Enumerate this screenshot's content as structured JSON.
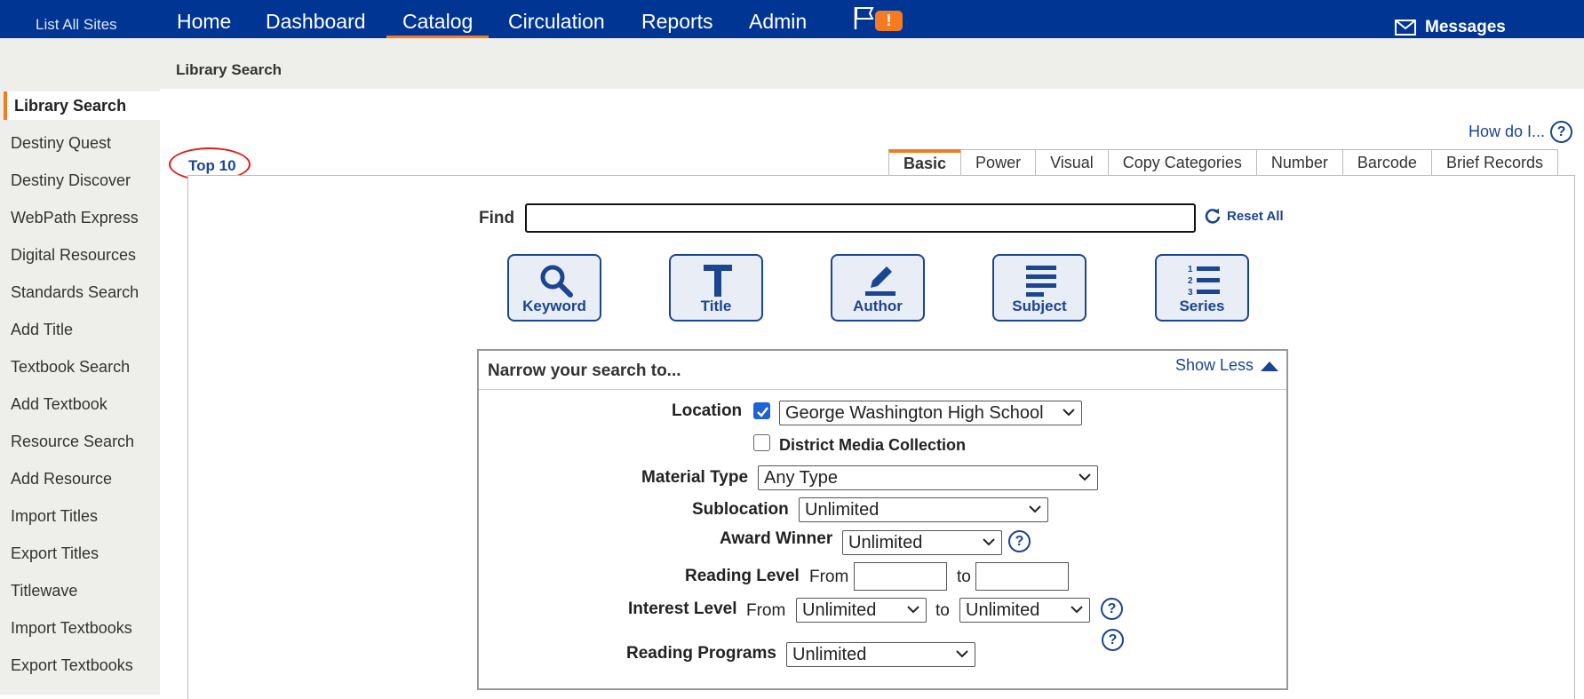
{
  "topbar": {
    "all_sites": "List All Sites",
    "nav": [
      "Home",
      "Dashboard",
      "Catalog",
      "Circulation",
      "Reports",
      "Admin"
    ],
    "alert_badge": "!",
    "messages": "Messages",
    "accent_color": "#f47b20",
    "bar_color": "#003594"
  },
  "breadcrumb": "Library Search",
  "sidebar": {
    "items": [
      "Library Search",
      "Destiny Quest",
      "Destiny Discover",
      "WebPath Express",
      "Digital Resources",
      "Standards Search",
      "Add Title",
      "Textbook Search",
      "Add Textbook",
      "Resource Search",
      "Add Resource",
      "Import Titles",
      "Export Titles",
      "Titlewave",
      "Import Textbooks",
      "Export Textbooks"
    ]
  },
  "how_do_i": "How do I...",
  "top10": "Top 10",
  "tabs": [
    "Basic",
    "Power",
    "Visual",
    "Copy Categories",
    "Number",
    "Barcode",
    "Brief Records"
  ],
  "find": {
    "label": "Find",
    "value": "",
    "reset": "Reset All"
  },
  "search_buttons": [
    "Keyword",
    "Title",
    "Author",
    "Subject",
    "Series"
  ],
  "narrow": {
    "title": "Narrow your search to...",
    "show_less": "Show Less",
    "location_label": "Location",
    "location_value": "George Washington High School",
    "district_label": "District Media Collection",
    "material_type_label": "Material Type",
    "material_type_value": "Any Type",
    "sublocation_label": "Sublocation",
    "sublocation_value": "Unlimited",
    "award_label": "Award Winner",
    "award_value": "Unlimited",
    "reading_level_label": "Reading Level",
    "from": "From",
    "to": "to",
    "interest_label": "Interest Level",
    "interest_from_value": "Unlimited",
    "interest_to_value": "Unlimited",
    "reading_programs_label": "Reading Programs",
    "reading_programs_value": "Unlimited"
  }
}
